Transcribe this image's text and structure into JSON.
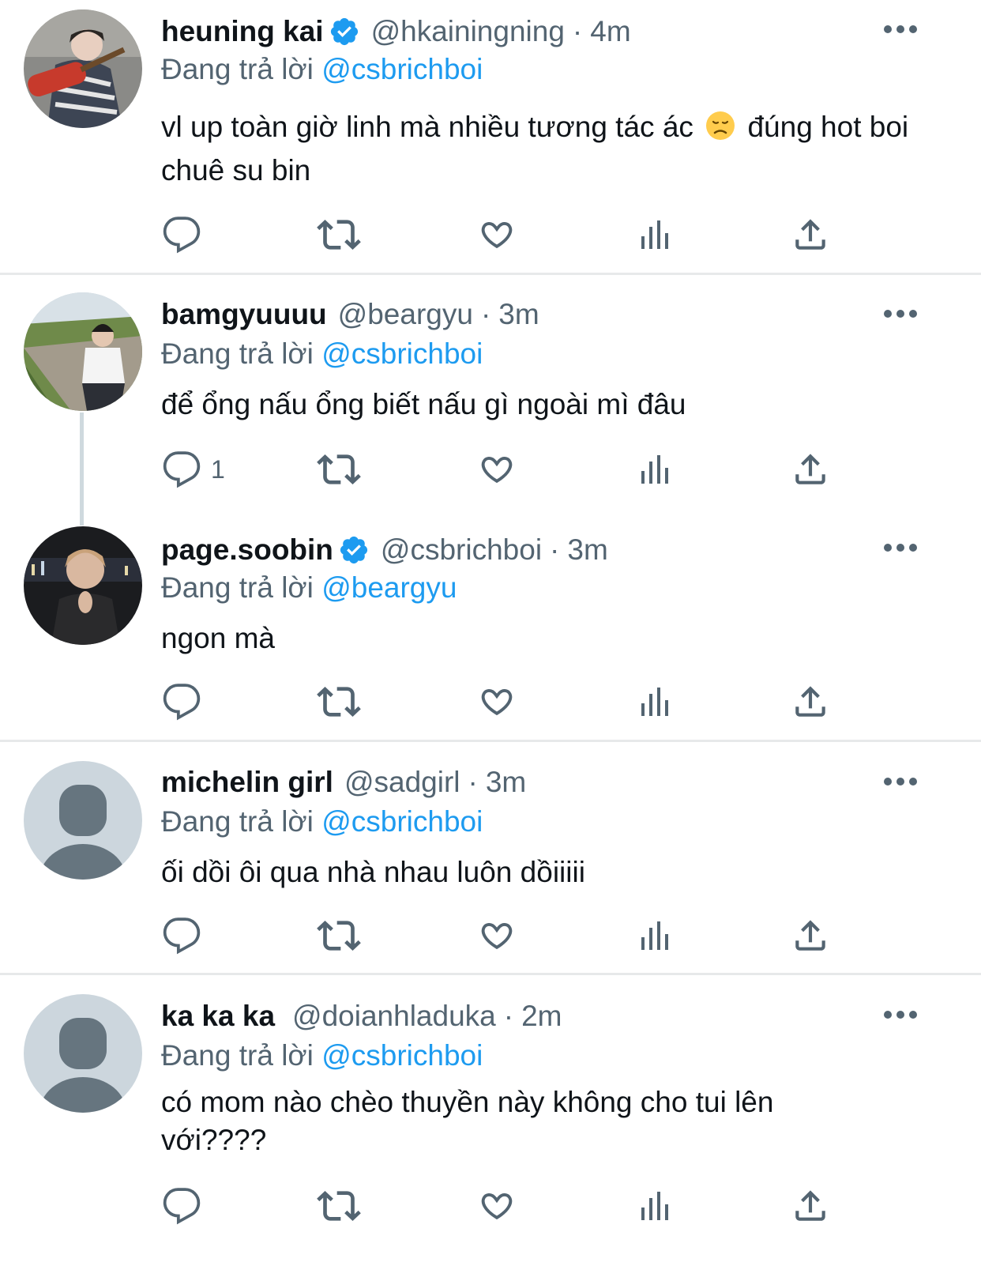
{
  "reply_prefix": "Đang trả lời",
  "colors": {
    "accent": "#1d9bf0",
    "secondary_text": "#536471",
    "divider": "#e7e9ea",
    "default_avatar_bg": "#ccd6dd",
    "default_avatar_fg": "#66757f"
  },
  "tweets": [
    {
      "name": "heuning kai",
      "verified": true,
      "handle": "@hkainingning",
      "sep": "·",
      "time": "4m",
      "reply_to": "@csbrichboi",
      "text_a": "vl up toàn giờ linh mà nhiều tương tác ác",
      "emoji": "disappointed-face-emoji",
      "text_b": "đúng hot boi chuê su bin",
      "reply_count": ""
    },
    {
      "name": "bamgyuuuu",
      "verified": false,
      "handle": "@beargyu",
      "sep": "·",
      "time": "3m",
      "reply_to": "@csbrichboi",
      "text": "để ổng nấu ổng biết nấu gì ngoài mì đâu",
      "reply_count": "1"
    },
    {
      "name": "page.soobin",
      "verified": true,
      "handle": "@csbrichboi",
      "sep": "·",
      "time": "3m",
      "reply_to": "@beargyu",
      "text": "ngon mà",
      "reply_count": ""
    },
    {
      "name": "michelin girl",
      "verified": false,
      "handle": "@sadgirl",
      "sep": "·",
      "time": "3m",
      "reply_to": "@csbrichboi",
      "text": "ối dồi ôi qua nhà nhau luôn dồiiiii",
      "reply_count": ""
    },
    {
      "name": "ka ka ka",
      "verified": false,
      "handle": "@doianhladuka",
      "sep": "·",
      "time": "2m",
      "reply_to": "@csbrichboi",
      "text": "có mom nào chèo thuyền này không cho tui lên với????",
      "reply_count": ""
    }
  ]
}
